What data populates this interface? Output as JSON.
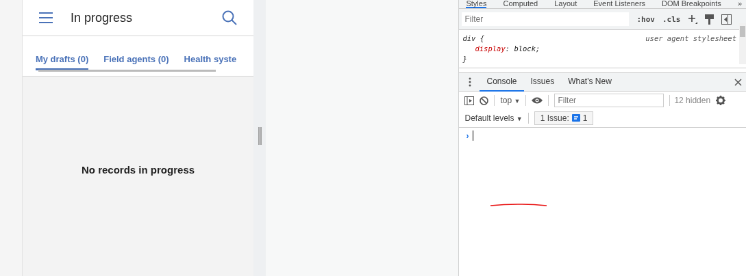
{
  "app": {
    "title": "In progress",
    "tabs": [
      {
        "label": "My drafts (0)",
        "selected": true
      },
      {
        "label": "Field agents (0)",
        "selected": false
      },
      {
        "label": "Health syste",
        "selected": false
      }
    ],
    "empty_message": "No records in progress"
  },
  "devtools": {
    "top_tabs": [
      {
        "label": "Styles",
        "selected": true
      },
      {
        "label": "Computed",
        "selected": false
      },
      {
        "label": "Layout",
        "selected": false
      },
      {
        "label": "Event Listeners",
        "selected": false
      },
      {
        "label": "DOM Breakpoints",
        "selected": false
      }
    ],
    "overflow": "»",
    "styles": {
      "filter_placeholder": "Filter",
      "hov": ":hov",
      "cls": ".cls",
      "selector": "div {",
      "source": "user agent stylesheet",
      "property": "display",
      "colon": ":",
      "value": "block;",
      "close": "}"
    },
    "drawer_tabs": [
      {
        "label": "Console",
        "selected": true
      },
      {
        "label": "Issues",
        "selected": false
      },
      {
        "label": "What's New",
        "selected": false
      }
    ],
    "console": {
      "context": "top",
      "context_arrow": "▼",
      "levels_arrow": "▼",
      "filter_placeholder": "Filter",
      "hidden": "12 hidden",
      "levels": "Default levels",
      "issues_label": "1 Issue:",
      "issues_count": "1",
      "prompt": "›"
    }
  }
}
